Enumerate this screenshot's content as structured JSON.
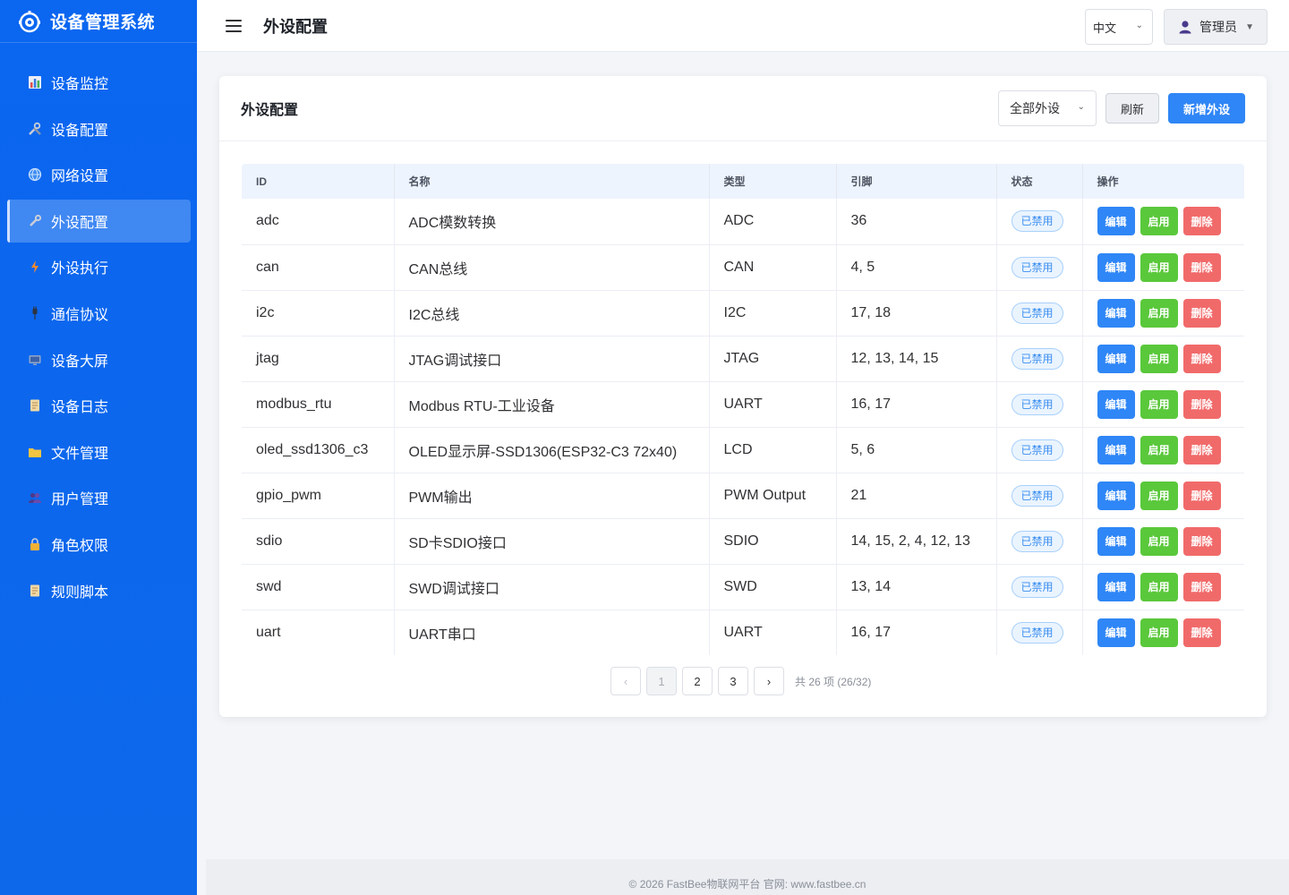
{
  "brand": {
    "title": "设备管理系统",
    "logo_icon": "robot-logo-icon"
  },
  "sidebar": {
    "items": [
      {
        "label": "设备监控",
        "icon": "bar-chart-icon",
        "active": false
      },
      {
        "label": "设备配置",
        "icon": "tools-icon",
        "active": false
      },
      {
        "label": "网络设置",
        "icon": "globe-icon",
        "active": false
      },
      {
        "label": "外设配置",
        "icon": "wrench-icon",
        "active": true
      },
      {
        "label": "外设执行",
        "icon": "lightning-icon",
        "active": false
      },
      {
        "label": "通信协议",
        "icon": "plug-icon",
        "active": false
      },
      {
        "label": "设备大屏",
        "icon": "monitor-icon",
        "active": false
      },
      {
        "label": "设备日志",
        "icon": "scroll-icon",
        "active": false
      },
      {
        "label": "文件管理",
        "icon": "folder-icon",
        "active": false
      },
      {
        "label": "用户管理",
        "icon": "users-icon",
        "active": false
      },
      {
        "label": "角色权限",
        "icon": "lock-icon",
        "active": false
      },
      {
        "label": "规则脚本",
        "icon": "script-icon",
        "active": false
      }
    ]
  },
  "header": {
    "title": "外设配置",
    "language": "中文",
    "user": "管理员"
  },
  "card": {
    "title": "外设配置",
    "filter_value": "全部外设",
    "refresh_label": "刷新",
    "add_label": "新增外设"
  },
  "table": {
    "columns": [
      "ID",
      "名称",
      "类型",
      "引脚",
      "状态",
      "操作"
    ],
    "rows": [
      {
        "id": "adc",
        "name": "ADC模数转换",
        "type": "ADC",
        "pins": "36",
        "status": "已禁用"
      },
      {
        "id": "can",
        "name": "CAN总线",
        "type": "CAN",
        "pins": "4, 5",
        "status": "已禁用"
      },
      {
        "id": "i2c",
        "name": "I2C总线",
        "type": "I2C",
        "pins": "17, 18",
        "status": "已禁用"
      },
      {
        "id": "jtag",
        "name": "JTAG调试接口",
        "type": "JTAG",
        "pins": "12, 13, 14, 15",
        "status": "已禁用"
      },
      {
        "id": "modbus_rtu",
        "name": "Modbus RTU-工业设备",
        "type": "UART",
        "pins": "16, 17",
        "status": "已禁用"
      },
      {
        "id": "oled_ssd1306_c3",
        "name": "OLED显示屏-SSD1306(ESP32-C3 72x40)",
        "type": "LCD",
        "pins": "5, 6",
        "status": "已禁用"
      },
      {
        "id": "gpio_pwm",
        "name": "PWM输出",
        "type": "PWM Output",
        "pins": "21",
        "status": "已禁用"
      },
      {
        "id": "sdio",
        "name": "SD卡SDIO接口",
        "type": "SDIO",
        "pins": "14, 15, 2, 4, 12, 13",
        "status": "已禁用"
      },
      {
        "id": "swd",
        "name": "SWD调试接口",
        "type": "SWD",
        "pins": "13, 14",
        "status": "已禁用"
      },
      {
        "id": "uart",
        "name": "UART串口",
        "type": "UART",
        "pins": "16, 17",
        "status": "已禁用"
      }
    ],
    "actions": {
      "edit": "编辑",
      "enable": "启用",
      "delete": "删除"
    }
  },
  "pagination": {
    "prev": "‹",
    "next": "›",
    "pages": [
      "1",
      "2",
      "3"
    ],
    "current": "1",
    "info": "共 26 项 (26/32)"
  },
  "footer": {
    "text": "© 2026 FastBee物联网平台 官网: www.fastbee.cn"
  },
  "colors": {
    "primary": "#2f86f6",
    "sidebar": "#0b66f0",
    "success": "#5ac83b",
    "danger": "#f16a6a"
  }
}
